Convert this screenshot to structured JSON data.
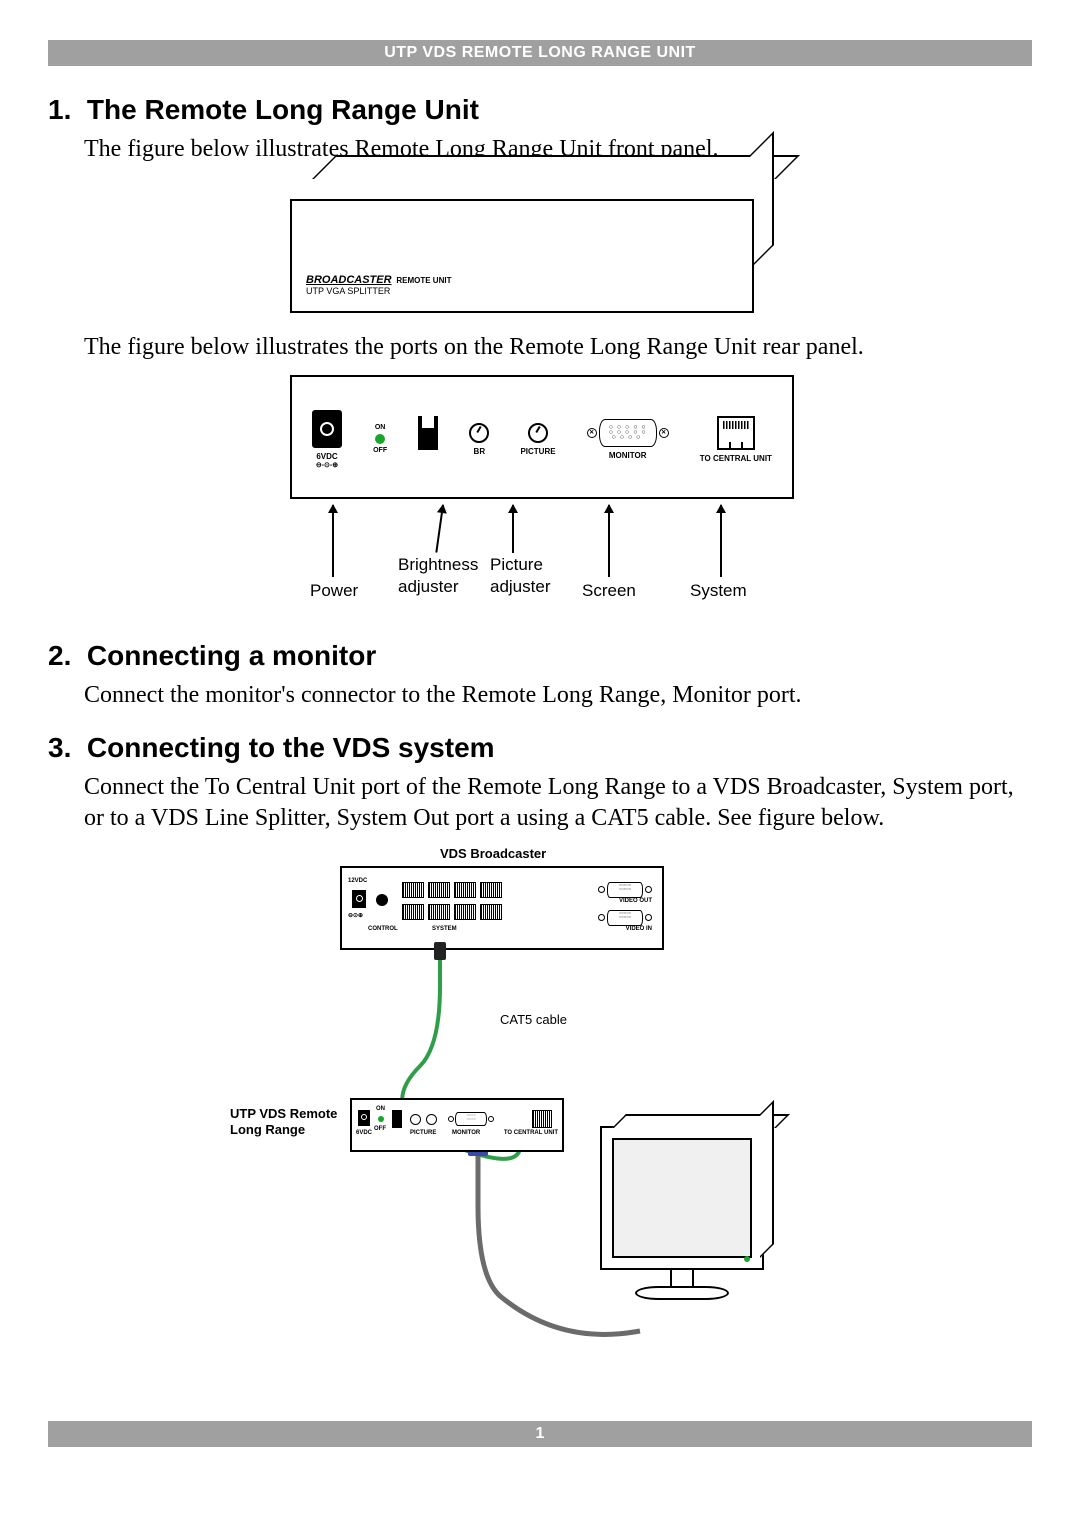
{
  "header": "UTP VDS REMOTE LONG RANGE UNIT",
  "footer_page": "1",
  "sections": {
    "s1": {
      "num": "1.",
      "title": "The Remote Long Range Unit"
    },
    "s2": {
      "num": "2.",
      "title": "Connecting a monitor"
    },
    "s3": {
      "num": "3.",
      "title": "Connecting to the VDS system"
    }
  },
  "body": {
    "p1": "The figure below illustrates Remote Long Range Unit front panel.",
    "p2": "The figure below illustrates the ports on the Remote Long Range Unit rear panel.",
    "p3": "Connect the monitor's connector to the Remote Long Range, Monitor port.",
    "p4": "Connect the To Central Unit port of the Remote Long Range to a VDS Broadcaster, System port, or to a VDS Line Splitter, System Out port a using a CAT5 cable. See figure below."
  },
  "front_panel": {
    "broadcaster": "BROADCASTER",
    "remote": "REMOTE UNIT",
    "splitter": "UTP VGA  SPLITTER"
  },
  "rear_panel": {
    "power_label": "6VDC",
    "power_polarity": "⊖-⊙-⊕",
    "led_on": "ON",
    "led_off": "OFF",
    "br": "BR",
    "picture": "PICTURE",
    "monitor": "MONITOR",
    "to_central": "TO CENTRAL UNIT"
  },
  "callouts": {
    "power": "Power",
    "brightness": "Brightness adjuster",
    "brightness_l1": "Brightness",
    "brightness_l2": "adjuster",
    "picture_l1": "Picture",
    "picture_l2": "adjuster",
    "screen": "Screen",
    "system": "System"
  },
  "conn": {
    "title_top": "VDS Broadcaster",
    "side_label": "UTP VDS Remote Long Range",
    "side_label_l1": "UTP VDS Remote",
    "side_label_l2": "Long Range",
    "cat5": "CAT5 cable",
    "bc_12vdc": "12VDC",
    "bc_control": "CONTROL",
    "bc_system": "SYSTEM",
    "bc_video_out": "VIDEO OUT",
    "bc_video_in": "VIDEO IN",
    "r_6vdc": "6VDC",
    "r_on": "ON",
    "r_off": "OFF",
    "r_picture": "PICTURE",
    "r_monitor": "MONITOR",
    "r_to_central": "TO CENTRAL UNIT"
  }
}
